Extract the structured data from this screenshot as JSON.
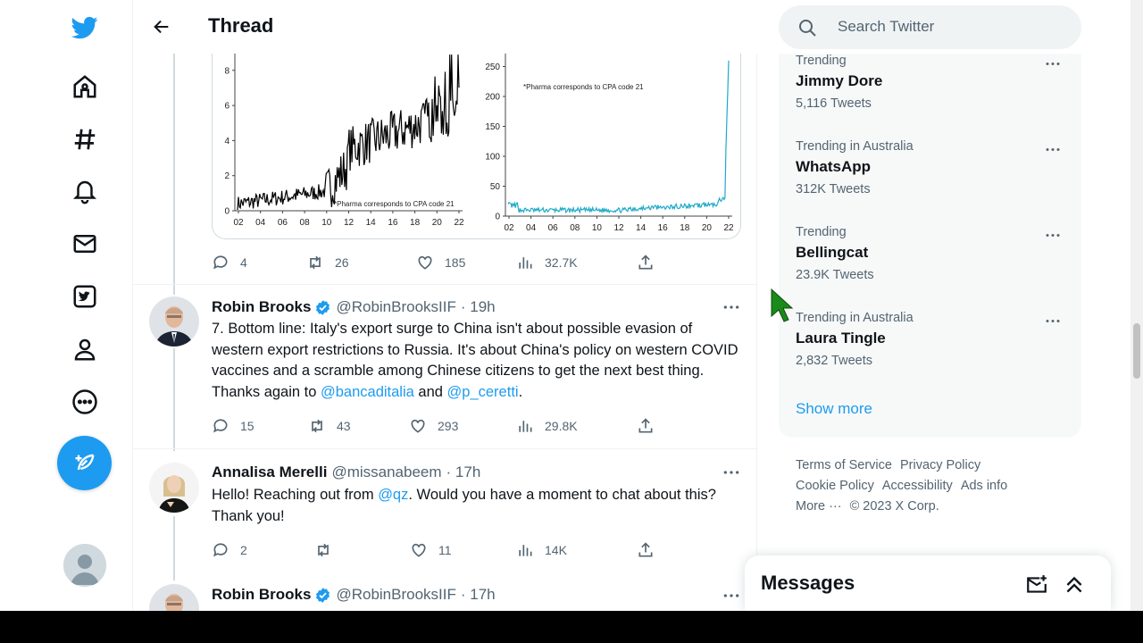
{
  "header": {
    "title": "Thread"
  },
  "chart_image": {
    "left": {
      "y_ticks": [
        "0",
        "2",
        "4",
        "6",
        "8"
      ],
      "x_ticks": [
        "02",
        "04",
        "06",
        "08",
        "10",
        "12",
        "14",
        "16",
        "18",
        "20",
        "22"
      ],
      "note": "*Pharma corresponds to CPA code 21",
      "color": "#000000"
    },
    "right": {
      "y_ticks": [
        "0",
        "50",
        "100",
        "150",
        "200",
        "250"
      ],
      "x_ticks": [
        "02",
        "04",
        "06",
        "08",
        "10",
        "12",
        "14",
        "16",
        "18",
        "20",
        "22"
      ],
      "note": "*Pharma corresponds to CPA code 21",
      "color": "#1fa9c9"
    }
  },
  "prev_tweet_actions": {
    "replies": "4",
    "retweets": "26",
    "likes": "185",
    "views": "32.7K"
  },
  "tweets": [
    {
      "name": "Robin Brooks",
      "handle": "@RobinBrooksIIF",
      "time": "· 19h",
      "text_before": "7. Bottom line: Italy's export surge to China isn't about possible evasion of western export restrictions to Russia. It's about China's policy on western COVID vaccines and a scramble among Chinese citizens to get the next best thing. Thanks again to ",
      "link1": "@bancaditalia",
      "mid": " and ",
      "link2": "@p_ceretti",
      "after": ".",
      "replies": "15",
      "retweets": "43",
      "likes": "293",
      "views": "29.8K"
    },
    {
      "name": "Annalisa Merelli",
      "handle": "@missanabeem",
      "time": "· 17h",
      "text_before": "Hello! Reaching out from ",
      "link1": "@qz",
      "after": ". Would you have a moment to chat about this? Thank you!",
      "replies": "2",
      "retweets": "",
      "likes": "11",
      "views": "14K"
    },
    {
      "name": "Robin Brooks",
      "handle": "@RobinBrooksIIF",
      "time": "· 17h"
    }
  ],
  "search": {
    "placeholder": "Search Twitter"
  },
  "trends": [
    {
      "context": "Trending",
      "name": "Jimmy Dore",
      "count": "5,116 Tweets"
    },
    {
      "context": "Trending in Australia",
      "name": "WhatsApp",
      "count": "312K Tweets"
    },
    {
      "context": "Trending",
      "name": "Bellingcat",
      "count": "23.9K Tweets"
    },
    {
      "context": "Trending in Australia",
      "name": "Laura Tingle",
      "count": "2,832 Tweets"
    }
  ],
  "show_more": "Show more",
  "footer": {
    "terms": "Terms of Service",
    "privacy": "Privacy Policy",
    "cookie": "Cookie Policy",
    "accessibility": "Accessibility",
    "ads": "Ads info",
    "more": "More ···",
    "copyright": "© 2023 X Corp."
  },
  "messages": {
    "title": "Messages"
  },
  "colors": {
    "accent": "#1d9bf0",
    "text": "#0f1419",
    "muted": "#536471"
  }
}
